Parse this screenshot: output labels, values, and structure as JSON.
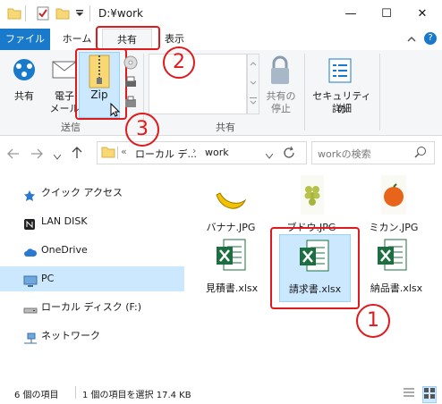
{
  "window": {
    "title": "D:¥work"
  },
  "tabs": {
    "file": "ファイル",
    "home": "ホーム",
    "share": "共有",
    "view": "表示"
  },
  "ribbon": {
    "share_label": "共有",
    "email_label_1": "電子",
    "email_label_2": "メール",
    "zip_label": "Zip",
    "send_group": "送信",
    "stop_share_label_1": "共有の",
    "stop_share_label_2": "停止",
    "share_group": "共有",
    "security_label_1": "セキュリティの",
    "security_label_2": "詳細"
  },
  "address": {
    "prefix": "«",
    "crumb1": "ローカル デ...",
    "crumb2": "work",
    "search_placeholder": "workの検索"
  },
  "nav": {
    "items": [
      {
        "label": "クイック アクセス",
        "icon": "star-icon"
      },
      {
        "label": "LAN DISK",
        "icon": "nas-icon"
      },
      {
        "label": "OneDrive",
        "icon": "cloud-icon"
      },
      {
        "label": "PC",
        "icon": "pc-icon"
      },
      {
        "label": "ローカル ディスク (F:)",
        "icon": "drive-icon"
      },
      {
        "label": "ネットワーク",
        "icon": "network-icon"
      }
    ]
  },
  "files": [
    {
      "name": "バナナ.JPG",
      "kind": "banana-image"
    },
    {
      "name": "ブドウ.JPG",
      "kind": "grape-image"
    },
    {
      "name": "ミカン.JPG",
      "kind": "orange-image"
    },
    {
      "name": "見積書.xlsx",
      "kind": "excel"
    },
    {
      "name": "請求書.xlsx",
      "kind": "excel"
    },
    {
      "name": "納品書.xlsx",
      "kind": "excel"
    }
  ],
  "status": {
    "count": "6 個の項目",
    "selected": "1 個の項目を選択  17.4 KB"
  },
  "callouts": {
    "one": "1",
    "two": "2",
    "three": "3"
  },
  "colors": {
    "accent": "#1979ca",
    "annotation": "#e0191c",
    "selection": "#cce8ff",
    "excel": "#1d6f42"
  }
}
